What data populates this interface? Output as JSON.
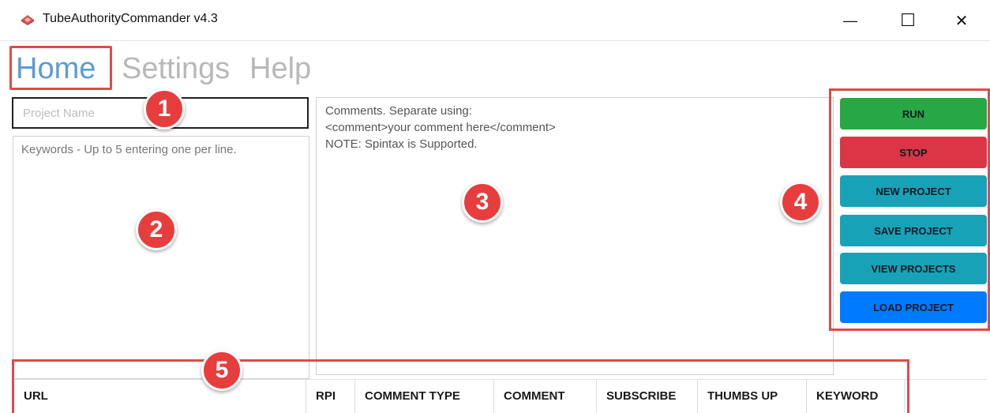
{
  "window": {
    "title": "TubeAuthorityCommander v4.3",
    "minimize_glyph": "—",
    "maximize_glyph": "☐",
    "close_glyph": "✕"
  },
  "menu": {
    "tabs": [
      {
        "label": "Home",
        "active": true
      },
      {
        "label": "Settings",
        "active": false
      },
      {
        "label": "Help",
        "active": false
      }
    ]
  },
  "form": {
    "project_name_placeholder": "Project Name",
    "keywords_placeholder": "Keywords - Up to 5 entering one per line.",
    "comments_placeholder": "Comments. Separate using:\n<comment>your comment here</comment>\nNOTE: Spintax is Supported."
  },
  "buttons": {
    "run": "RUN",
    "stop": "STOP",
    "new_project": "NEW PROJECT",
    "save_project": "SAVE PROJECT",
    "view_projects": "VIEW PROJECTS",
    "load_project": "LOAD PROJECT"
  },
  "table": {
    "columns": [
      "URL",
      "RPI",
      "COMMENT TYPE",
      "COMMENT",
      "SUBSCRIBE",
      "THUMBS UP",
      "KEYWORD"
    ]
  },
  "annotations": [
    "1",
    "2",
    "3",
    "4",
    "5"
  ],
  "colors": {
    "run": "#28a745",
    "stop": "#dc3545",
    "teal": "#17a2b8",
    "load": "#007bff",
    "highlight": "#e04a4a",
    "active_tab": "#5b9bd5"
  },
  "icons": {
    "app": "app-logo-icon"
  }
}
